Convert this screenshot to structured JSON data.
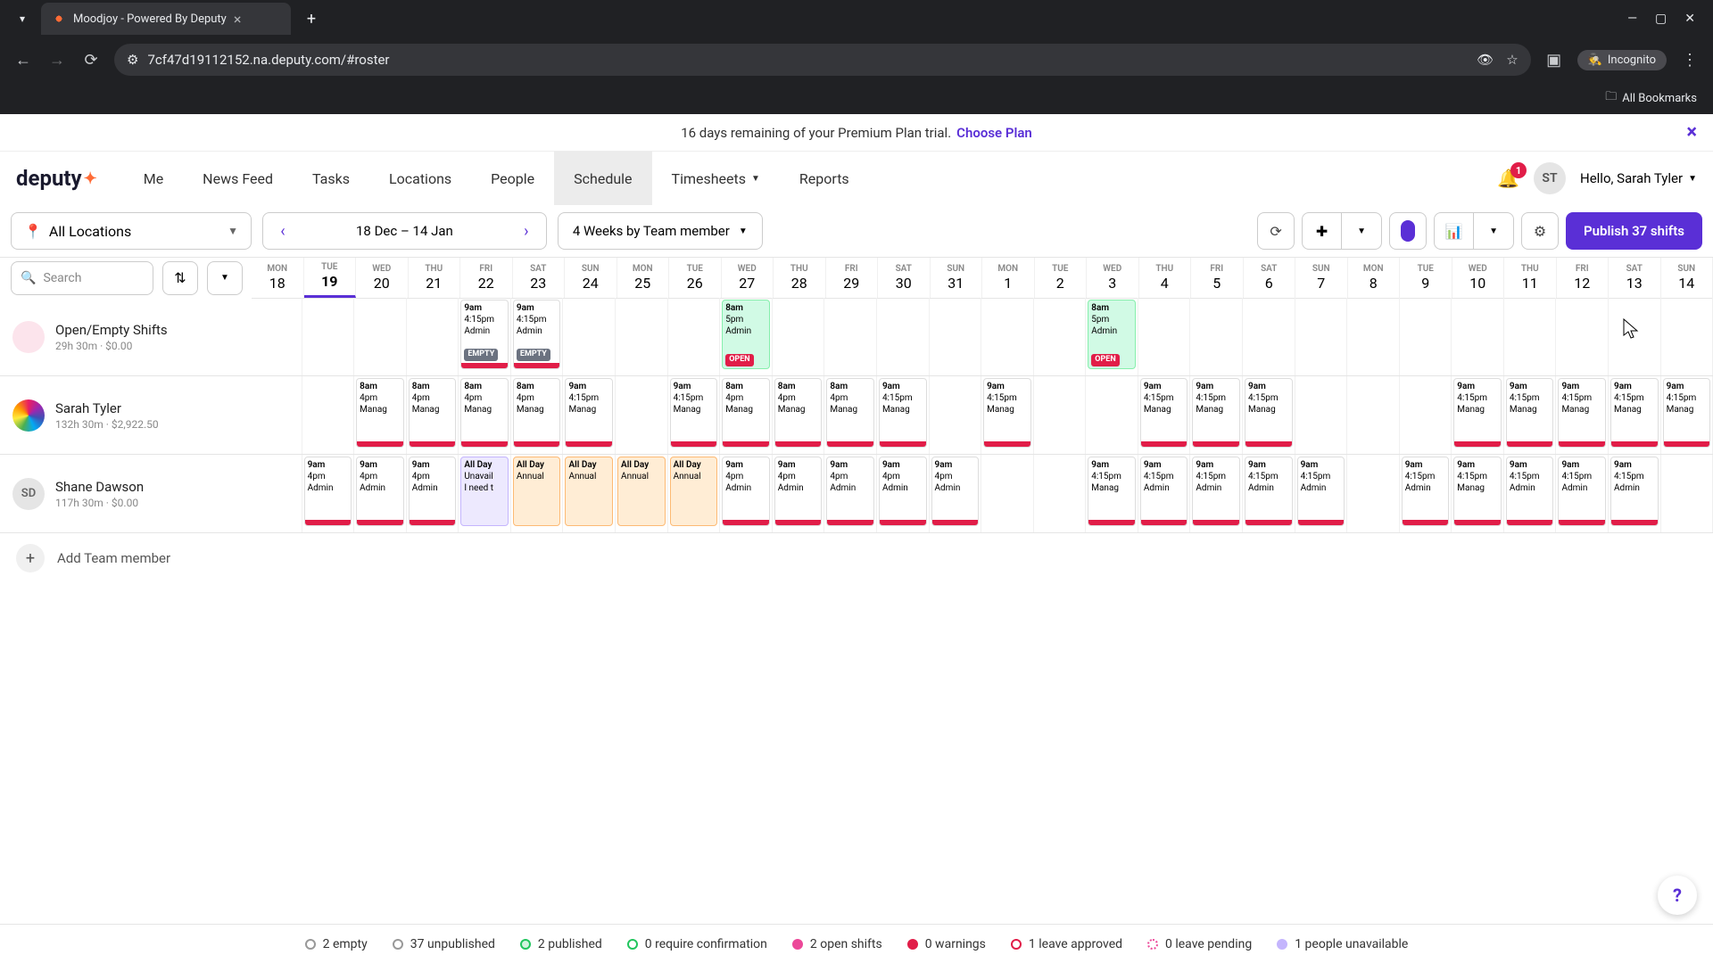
{
  "browser": {
    "tab_title": "Moodjoy - Powered By Deputy",
    "url": "7cf47d19112152.na.deputy.com/#roster",
    "incognito_label": "Incognito",
    "bookmarks_label": "All Bookmarks"
  },
  "banner": {
    "text": "16 days remaining of your Premium Plan trial.",
    "cta": "Choose Plan"
  },
  "logo": "deputy",
  "nav": {
    "items": [
      "Me",
      "News Feed",
      "Tasks",
      "Locations",
      "People",
      "Schedule",
      "Timesheets",
      "Reports"
    ],
    "active": "Schedule"
  },
  "notifications_count": "1",
  "user_initials": "ST",
  "greeting": "Hello, Sarah Tyler",
  "toolbar": {
    "location": "All Locations",
    "date_range": "18 Dec – 14 Jan",
    "view_mode": "4 Weeks by Team member",
    "publish_label": "Publish 37 shifts"
  },
  "search_placeholder": "Search",
  "days": [
    {
      "dow": "MON",
      "num": "18"
    },
    {
      "dow": "TUE",
      "num": "19",
      "today": true
    },
    {
      "dow": "WED",
      "num": "20"
    },
    {
      "dow": "THU",
      "num": "21"
    },
    {
      "dow": "FRI",
      "num": "22"
    },
    {
      "dow": "SAT",
      "num": "23"
    },
    {
      "dow": "SUN",
      "num": "24"
    },
    {
      "dow": "MON",
      "num": "25"
    },
    {
      "dow": "TUE",
      "num": "26"
    },
    {
      "dow": "WED",
      "num": "27"
    },
    {
      "dow": "THU",
      "num": "28"
    },
    {
      "dow": "FRI",
      "num": "29"
    },
    {
      "dow": "SAT",
      "num": "30"
    },
    {
      "dow": "SUN",
      "num": "31"
    },
    {
      "dow": "MON",
      "num": "1"
    },
    {
      "dow": "TUE",
      "num": "2"
    },
    {
      "dow": "WED",
      "num": "3"
    },
    {
      "dow": "THU",
      "num": "4"
    },
    {
      "dow": "FRI",
      "num": "5"
    },
    {
      "dow": "SAT",
      "num": "6"
    },
    {
      "dow": "SUN",
      "num": "7"
    },
    {
      "dow": "MON",
      "num": "8"
    },
    {
      "dow": "TUE",
      "num": "9"
    },
    {
      "dow": "WED",
      "num": "10"
    },
    {
      "dow": "THU",
      "num": "11"
    },
    {
      "dow": "FRI",
      "num": "12"
    },
    {
      "dow": "SAT",
      "num": "13"
    },
    {
      "dow": "SUN",
      "num": "14"
    }
  ],
  "rows": [
    {
      "name": "Open/Empty Shifts",
      "meta": "29h 30m · $0.00",
      "avatar": "pink",
      "avatar_text": "",
      "shifts": {
        "4": {
          "l1": "9am",
          "l2": "4:15pm",
          "l3": "Admin",
          "badge": "EMPTY",
          "style": "red-bot"
        },
        "5": {
          "l1": "9am",
          "l2": "4:15pm",
          "l3": "Admin",
          "badge": "EMPTY",
          "style": "red-bot"
        },
        "9": {
          "l1": "8am",
          "l2": "5pm",
          "l3": "Admin",
          "badge": "OPEN",
          "badge_cls": "open",
          "style": "green"
        },
        "16": {
          "l1": "8am",
          "l2": "5pm",
          "l3": "Admin",
          "badge": "OPEN",
          "badge_cls": "open",
          "style": "green"
        }
      }
    },
    {
      "name": "Sarah Tyler",
      "meta": "132h 30m · $2,922.50",
      "avatar": "rainbow",
      "avatar_text": "",
      "shifts": {
        "2": {
          "l1": "8am",
          "l2": "4pm",
          "l3": "Manag",
          "style": "red-bot"
        },
        "3": {
          "l1": "8am",
          "l2": "4pm",
          "l3": "Manag",
          "style": "red-bot"
        },
        "4": {
          "l1": "8am",
          "l2": "4pm",
          "l3": "Manag",
          "style": "red-bot"
        },
        "5": {
          "l1": "8am",
          "l2": "4pm",
          "l3": "Manag",
          "style": "red-bot"
        },
        "6": {
          "l1": "9am",
          "l2": "4:15pm",
          "l3": "Manag",
          "style": "red-bot"
        },
        "8": {
          "l1": "9am",
          "l2": "4:15pm",
          "l3": "Manag",
          "style": "red-bot"
        },
        "9": {
          "l1": "8am",
          "l2": "4pm",
          "l3": "Manag",
          "style": "red-bot"
        },
        "10": {
          "l1": "8am",
          "l2": "4pm",
          "l3": "Manag",
          "style": "red-bot"
        },
        "11": {
          "l1": "8am",
          "l2": "4pm",
          "l3": "Manag",
          "style": "red-bot"
        },
        "12": {
          "l1": "9am",
          "l2": "4:15pm",
          "l3": "Manag",
          "style": "red-bot"
        },
        "14": {
          "l1": "9am",
          "l2": "4:15pm",
          "l3": "Manag",
          "style": "red-bot"
        },
        "17": {
          "l1": "9am",
          "l2": "4:15pm",
          "l3": "Manag",
          "style": "red-bot"
        },
        "18": {
          "l1": "9am",
          "l2": "4:15pm",
          "l3": "Manag",
          "style": "red-bot"
        },
        "19": {
          "l1": "9am",
          "l2": "4:15pm",
          "l3": "Manag",
          "style": "red-bot"
        },
        "23": {
          "l1": "9am",
          "l2": "4:15pm",
          "l3": "Manag",
          "style": "red-bot"
        },
        "24": {
          "l1": "9am",
          "l2": "4:15pm",
          "l3": "Manag",
          "style": "red-bot"
        },
        "25": {
          "l1": "9am",
          "l2": "4:15pm",
          "l3": "Manag",
          "style": "red-bot"
        },
        "26": {
          "l1": "9am",
          "l2": "4:15pm",
          "l3": "Manag",
          "style": "red-bot"
        },
        "27": {
          "l1": "9am",
          "l2": "4:15pm",
          "l3": "Manag",
          "style": "red-bot"
        }
      }
    },
    {
      "name": "Shane Dawson",
      "meta": "117h 30m · $0.00",
      "avatar": "grey",
      "avatar_text": "SD",
      "shifts": {
        "1": {
          "l1": "9am",
          "l2": "4pm",
          "l3": "Admin",
          "style": "red-bot"
        },
        "2": {
          "l1": "9am",
          "l2": "4pm",
          "l3": "Admin",
          "style": "red-bot"
        },
        "3": {
          "l1": "9am",
          "l2": "4pm",
          "l3": "Admin",
          "style": "red-bot"
        },
        "4": {
          "l1": "All Day",
          "l2": "Unavail",
          "l3": "I need t",
          "style": "lav"
        },
        "5": {
          "l1": "All Day",
          "l2": "Annual",
          "l3": "",
          "style": "peach"
        },
        "6": {
          "l1": "All Day",
          "l2": "Annual",
          "l3": "",
          "style": "peach"
        },
        "7": {
          "l1": "All Day",
          "l2": "Annual",
          "l3": "",
          "style": "peach"
        },
        "8": {
          "l1": "All Day",
          "l2": "Annual",
          "l3": "",
          "style": "peach"
        },
        "9": {
          "l1": "9am",
          "l2": "4pm",
          "l3": "Admin",
          "style": "red-bot"
        },
        "10": {
          "l1": "9am",
          "l2": "4pm",
          "l3": "Admin",
          "style": "red-bot"
        },
        "11": {
          "l1": "9am",
          "l2": "4pm",
          "l3": "Admin",
          "style": "red-bot"
        },
        "12": {
          "l1": "9am",
          "l2": "4pm",
          "l3": "Admin",
          "style": "red-bot"
        },
        "13": {
          "l1": "9am",
          "l2": "4pm",
          "l3": "Admin",
          "style": "red-bot"
        },
        "16": {
          "l1": "9am",
          "l2": "4:15pm",
          "l3": "Manag",
          "style": "red-bot"
        },
        "17": {
          "l1": "9am",
          "l2": "4:15pm",
          "l3": "Admin",
          "style": "red-bot"
        },
        "18": {
          "l1": "9am",
          "l2": "4:15pm",
          "l3": "Admin",
          "style": "red-bot"
        },
        "19": {
          "l1": "9am",
          "l2": "4:15pm",
          "l3": "Admin",
          "style": "red-bot"
        },
        "20": {
          "l1": "9am",
          "l2": "4:15pm",
          "l3": "Admin",
          "style": "red-bot"
        },
        "22": {
          "l1": "9am",
          "l2": "4:15pm",
          "l3": "Admin",
          "style": "red-bot"
        },
        "23": {
          "l1": "9am",
          "l2": "4:15pm",
          "l3": "Manag",
          "style": "red-bot"
        },
        "24": {
          "l1": "9am",
          "l2": "4:15pm",
          "l3": "Admin",
          "style": "red-bot"
        },
        "25": {
          "l1": "9am",
          "l2": "4:15pm",
          "l3": "Admin",
          "style": "red-bot"
        },
        "26": {
          "l1": "9am",
          "l2": "4:15pm",
          "l3": "Admin",
          "style": "red-bot"
        }
      }
    }
  ],
  "add_member_label": "Add Team member",
  "legend": [
    {
      "cls": "empty",
      "text": "2 empty"
    },
    {
      "cls": "unpub",
      "text": "37 unpublished"
    },
    {
      "cls": "pub",
      "text": "2 published"
    },
    {
      "cls": "conf",
      "text": "0 require confirmation"
    },
    {
      "cls": "open",
      "text": "2 open shifts"
    },
    {
      "cls": "warn",
      "text": "0 warnings"
    },
    {
      "cls": "leave",
      "text": "1 leave approved"
    },
    {
      "cls": "pend",
      "text": "0 leave pending"
    },
    {
      "cls": "unavail",
      "text": "1 people unavailable"
    }
  ]
}
